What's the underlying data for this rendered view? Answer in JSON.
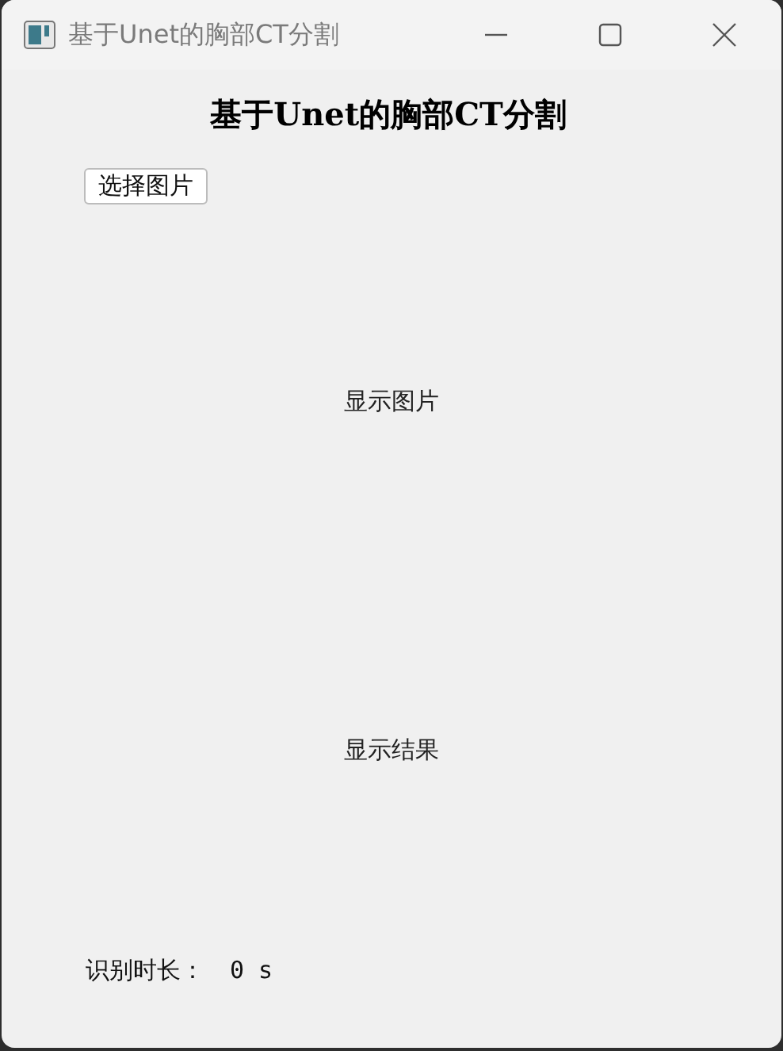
{
  "window": {
    "title": "基于Unet的胸部CT分割"
  },
  "heading": "基于Unet的胸部CT分割",
  "select_button": "选择图片",
  "image_label": "显示图片",
  "result_label": "显示结果",
  "duration": {
    "label": "识别时长：",
    "value": "0 s"
  }
}
